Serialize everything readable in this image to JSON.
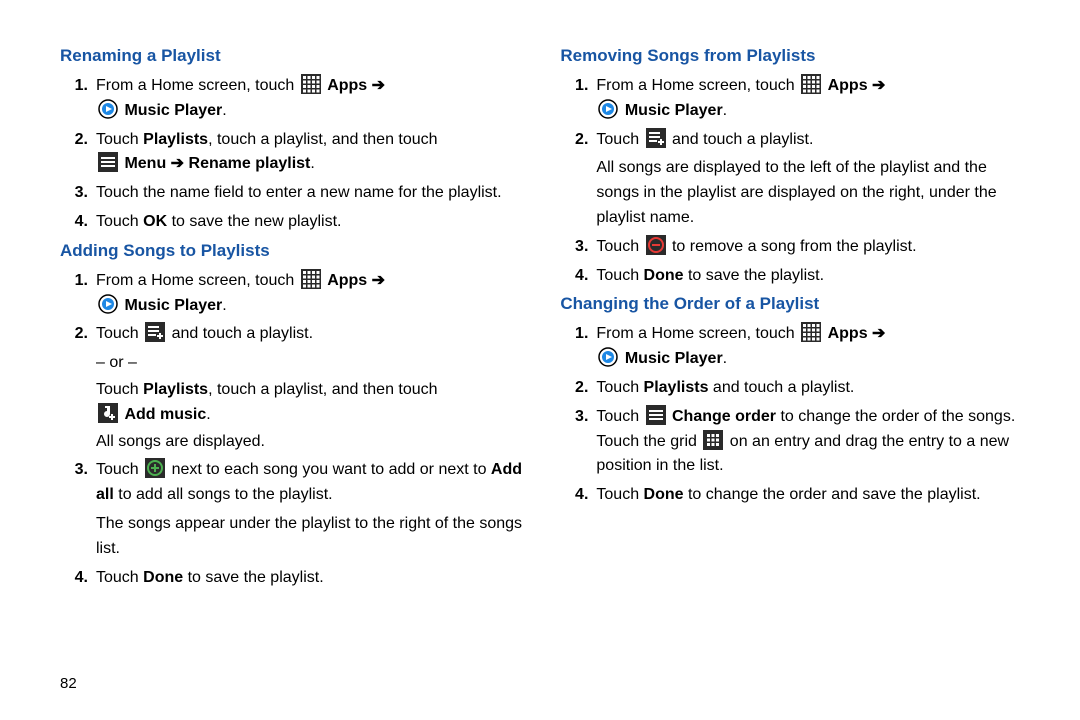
{
  "pagenum": "82",
  "apps": "Apps",
  "music_player": "Music Player",
  "s1": {
    "title": "Renaming a Playlist",
    "steps": {
      "n1": "1.",
      "t1a": "From a Home screen, touch ",
      "n2": "2.",
      "t2a": "Touch ",
      "t2b": "Playlists",
      "t2c": ", touch a playlist, and then touch ",
      "t2d": "Menu",
      "t2e": "Rename playlist",
      "n3": "3.",
      "t3": "Touch the name field to enter a new name for the playlist.",
      "n4": "4.",
      "t4a": "Touch ",
      "t4b": "OK",
      "t4c": " to save the new playlist."
    }
  },
  "s2": {
    "title": "Adding Songs to Playlists",
    "steps": {
      "n1": "1.",
      "t1a": "From a Home screen, touch ",
      "n2": "2.",
      "t2a": "Touch ",
      "t2b": " and touch a playlist.",
      "t2or": "– or –",
      "t2alt_a": "Touch ",
      "t2alt_b": "Playlists",
      "t2alt_c": ", touch a playlist, and then touch ",
      "t2add": "Add music",
      "t2disp": "All songs are displayed.",
      "n3": "3.",
      "t3a": "Touch ",
      "t3b": " next to each song you want to add or next to ",
      "t3c": "Add all",
      "t3d": " to add all songs to the playlist.",
      "t3e": "The songs appear under the playlist to the right of the songs list.",
      "n4": "4.",
      "t4a": "Touch ",
      "t4b": "Done",
      "t4c": " to save the playlist."
    }
  },
  "s3": {
    "title": "Removing Songs from Playlists",
    "steps": {
      "n1": "1.",
      "t1a": "From a Home screen, touch ",
      "n2": "2.",
      "t2a": "Touch ",
      "t2b": " and touch a playlist.",
      "t2c": "All songs are displayed to the left of the playlist and the songs in the playlist are displayed on the right, under the playlist name.",
      "n3": "3.",
      "t3a": "Touch ",
      "t3b": " to remove a song from the playlist.",
      "n4": "4.",
      "t4a": "Touch ",
      "t4b": "Done",
      "t4c": " to save the playlist."
    }
  },
  "s4": {
    "title": "Changing the Order of a Playlist",
    "steps": {
      "n1": "1.",
      "t1a": "From a Home screen, touch ",
      "n2": "2.",
      "t2a": "Touch ",
      "t2b": "Playlists",
      "t2c": " and touch a playlist.",
      "n3": "3.",
      "t3a": "Touch ",
      "t3b": "Change order",
      "t3c": " to change the order of the songs. Touch the grid ",
      "t3d": " on an entry and drag the entry to a new position in the list.",
      "n4": "4.",
      "t4a": "Touch ",
      "t4b": "Done",
      "t4c": " to change the order and save the playlist."
    }
  }
}
